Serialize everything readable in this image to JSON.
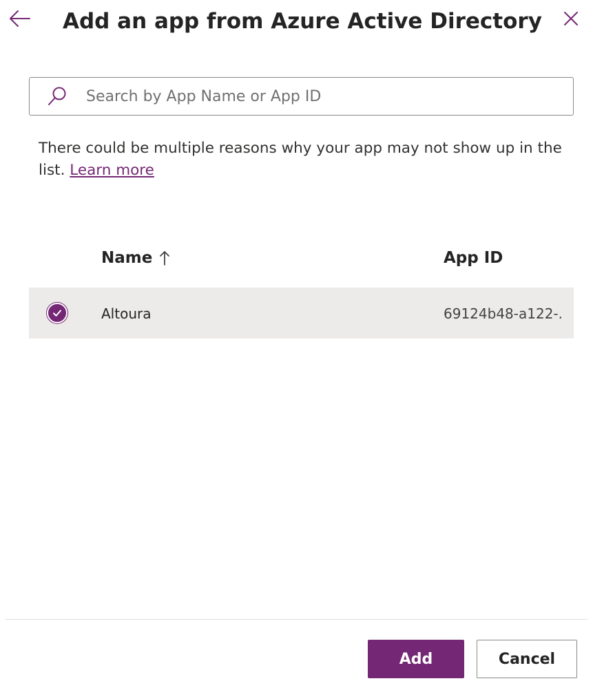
{
  "panel": {
    "title": "Add an app from Azure Active Directory"
  },
  "icons": {
    "back": "arrow-left-icon",
    "close": "close-icon",
    "search": "search-icon",
    "sort": "arrow-up-icon",
    "check": "checkmark-circle-icon"
  },
  "search": {
    "placeholder": "Search by App Name or App ID",
    "value": ""
  },
  "info": {
    "text": "There could be multiple reasons why your app may not show up in the list.",
    "link_label": "Learn more"
  },
  "table": {
    "columns": {
      "name": "Name",
      "app_id": "App ID"
    },
    "rows": [
      {
        "name": "Altoura",
        "app_id": "69124b48-a122-...",
        "selected": true
      }
    ]
  },
  "footer": {
    "add_label": "Add",
    "cancel_label": "Cancel"
  },
  "colors": {
    "accent": "#742774",
    "row_selected_bg": "#edebe9",
    "border": "#8a8886"
  }
}
